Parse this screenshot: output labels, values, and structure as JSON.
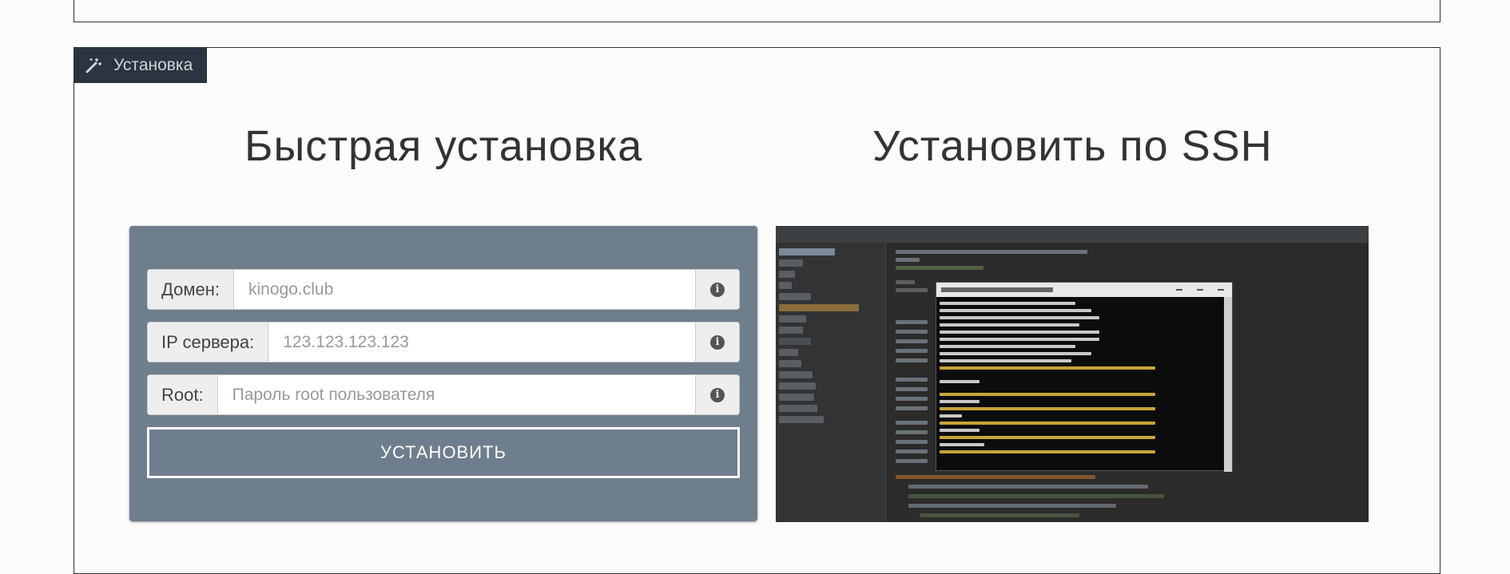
{
  "section": {
    "tab_label": "Установка",
    "quick_heading": "Быстрая установка",
    "ssh_heading": "Установить по SSH"
  },
  "form": {
    "domain_label": "Домен:",
    "domain_placeholder": "kinogo.club",
    "ip_label": "IP сервера:",
    "ip_placeholder": "123.123.123.123",
    "root_label": "Root:",
    "root_placeholder": "Пароль root пользователя",
    "install_button": "УСТАНОВИТЬ"
  },
  "icons": {
    "tab_icon": "magic-wand-icon",
    "info_icon": "info-circle-icon"
  },
  "colors": {
    "tab_bg": "#2b3440",
    "card_bg": "#6f7e8c",
    "terminal_bg": "#0c0c0c"
  }
}
